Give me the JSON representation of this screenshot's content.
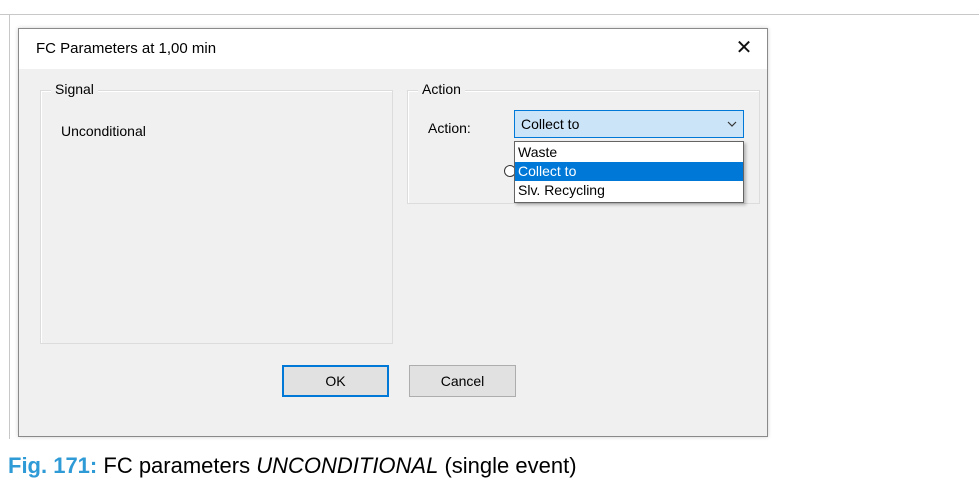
{
  "dialog": {
    "title": "FC Parameters at 1,00 min",
    "close_glyph": "✕"
  },
  "signal_group": {
    "label": "Signal",
    "value": "Unconditional"
  },
  "action_group": {
    "label": "Action",
    "field_label": "Action:",
    "selected": "Collect to",
    "options": [
      "Waste",
      "Collect to",
      "Slv. Recycling"
    ],
    "highlighted_index": 1
  },
  "buttons": {
    "ok": "OK",
    "cancel": "Cancel"
  },
  "caption": {
    "figure": "Fig. 171:",
    "text_before": "FC parameters",
    "emphasis": "UNCONDITIONAL",
    "text_after": "(single event)"
  },
  "colors": {
    "accent": "#0078d7",
    "combo_bg": "#cce4f7",
    "caption_accent": "#2e9ad6"
  },
  "icons": {
    "close": "close-icon",
    "combo_arrow": "chevron-down-icon"
  }
}
